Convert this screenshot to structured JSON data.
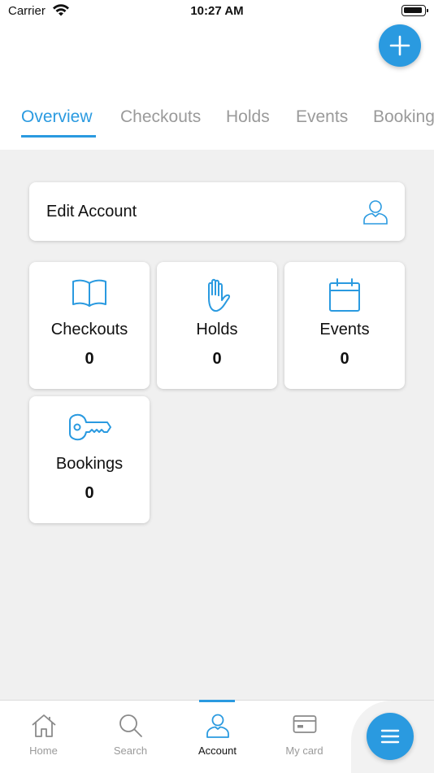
{
  "status_bar": {
    "carrier": "Carrier",
    "time": "10:27 AM"
  },
  "colors": {
    "accent": "#2a9ae0",
    "inactive": "#9a9a9a",
    "background": "#f0f0f0"
  },
  "tabs": [
    {
      "label": "Overview",
      "active": true
    },
    {
      "label": "Checkouts",
      "active": false
    },
    {
      "label": "Holds",
      "active": false
    },
    {
      "label": "Events",
      "active": false
    },
    {
      "label": "Bookings",
      "active": false
    }
  ],
  "edit_account": {
    "label": "Edit Account",
    "icon": "user-icon"
  },
  "tiles": [
    {
      "label": "Checkouts",
      "count": "0",
      "icon": "book-icon"
    },
    {
      "label": "Holds",
      "count": "0",
      "icon": "hand-icon"
    },
    {
      "label": "Events",
      "count": "0",
      "icon": "calendar-icon"
    },
    {
      "label": "Bookings",
      "count": "0",
      "icon": "key-icon"
    }
  ],
  "bottom_nav": [
    {
      "label": "Home",
      "icon": "home-icon",
      "active": false
    },
    {
      "label": "Search",
      "icon": "search-icon",
      "active": false
    },
    {
      "label": "Account",
      "icon": "account-icon",
      "active": true
    },
    {
      "label": "My card",
      "icon": "card-icon",
      "active": false
    }
  ],
  "fab": {
    "add_icon": "plus-icon",
    "menu_icon": "menu-icon"
  }
}
